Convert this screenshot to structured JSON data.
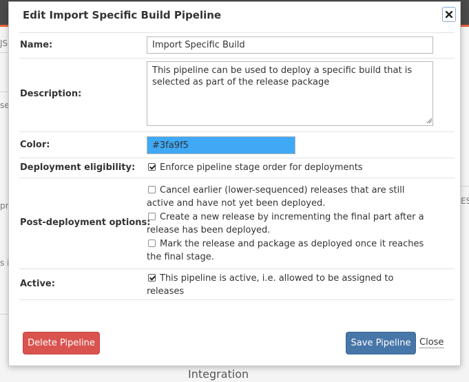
{
  "background": {
    "frag_left_1": "JS",
    "frag_left_2": "se",
    "frag_left_3": "pro",
    "frag_left_4": "s i",
    "frag_right_1": "ES",
    "integration": "Integration"
  },
  "modal": {
    "title": "Edit Import Specific Build Pipeline",
    "close_icon": "close-icon"
  },
  "form": {
    "name_label": "Name:",
    "name_value": "Import Specific Build",
    "description_label": "Description:",
    "description_value": "This pipeline can be used to deploy a specific build that is selected as part of the release package",
    "color_label": "Color:",
    "color_value": "#3fa9f5",
    "deployment_label": "Deployment eligibility:",
    "enforce_order": {
      "label": "Enforce pipeline stage order for deployments",
      "checked": true
    },
    "post_label": "Post-deployment options:",
    "post_options": [
      {
        "label": "Cancel earlier (lower-sequenced) releases that are still active and have not yet been deployed.",
        "checked": false
      },
      {
        "label": "Create a new release by incrementing the final part after a release has been deployed.",
        "checked": false
      },
      {
        "label": "Mark the release and package as deployed once it reaches the final stage.",
        "checked": false
      }
    ],
    "active_label": "Active:",
    "active_option": {
      "label": "This pipeline is active, i.e. allowed to be assigned to releases",
      "checked": true
    }
  },
  "buttons": {
    "delete": "Delete Pipeline",
    "save": "Save Pipeline",
    "close": "Close"
  },
  "colors": {
    "swatch": "#3fa9f5",
    "danger": "#d9534f",
    "primary": "#4776a8",
    "accent_bar": "#e8643c"
  }
}
